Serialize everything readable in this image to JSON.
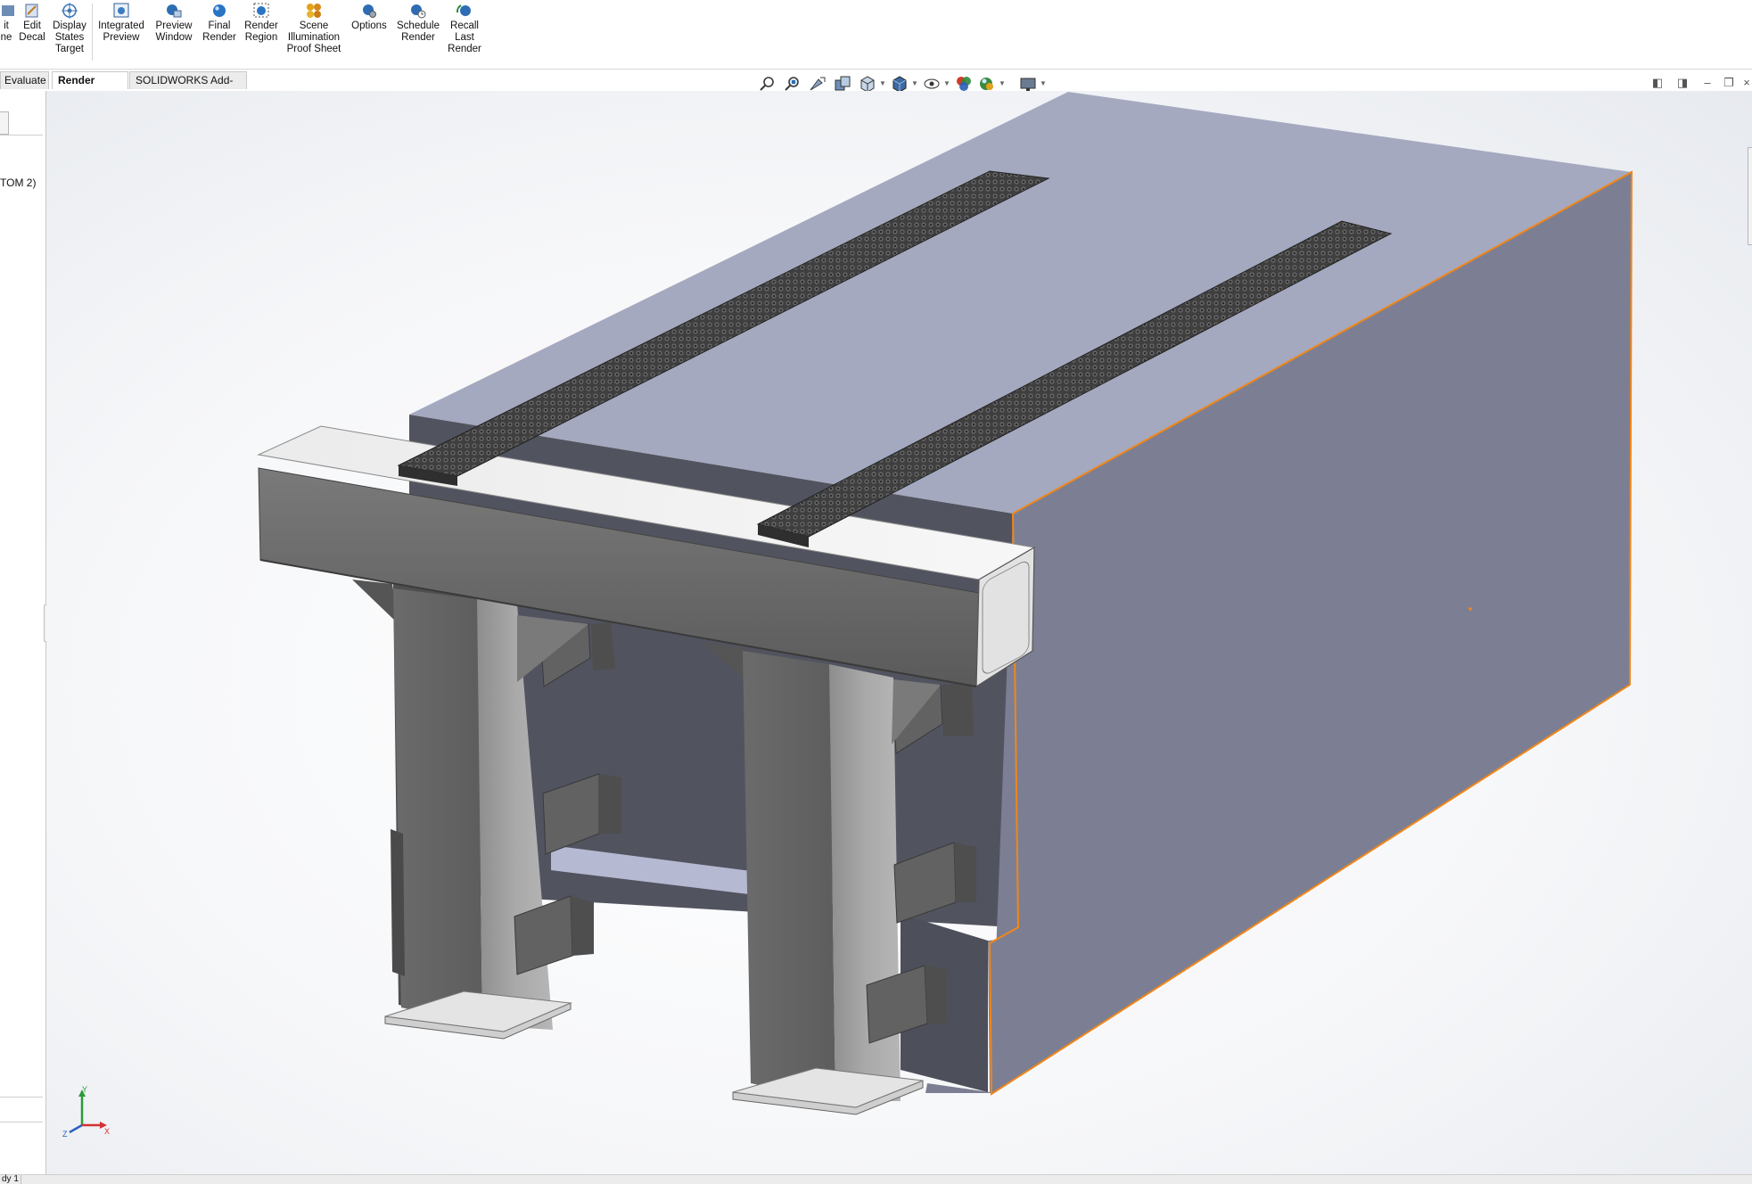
{
  "ribbon": {
    "buttons": [
      {
        "label": "it\nne",
        "icon": "edit-scene-icon"
      },
      {
        "label": "Edit\nDecal",
        "icon": "edit-decal-icon"
      },
      {
        "label": "Display\nStates\nTarget",
        "icon": "display-states-target-icon"
      },
      {
        "label": "Integrated\nPreview",
        "icon": "integrated-preview-icon"
      },
      {
        "label": "Preview\nWindow",
        "icon": "preview-window-icon"
      },
      {
        "label": "Final\nRender",
        "icon": "final-render-icon"
      },
      {
        "label": "Render\nRegion",
        "icon": "render-region-icon"
      },
      {
        "label": "Scene\nIllumination\nProof Sheet",
        "icon": "scene-illumination-icon"
      },
      {
        "label": "Options",
        "icon": "options-icon"
      },
      {
        "label": "Schedule\nRender",
        "icon": "schedule-render-icon"
      },
      {
        "label": "Recall\nLast\nRender",
        "icon": "recall-last-render-icon"
      }
    ]
  },
  "tabs": [
    {
      "label": "Evaluate",
      "active": false
    },
    {
      "label": "Render Tools",
      "active": true
    },
    {
      "label": "SOLIDWORKS Add-Ins",
      "active": false
    }
  ],
  "left_panel": {
    "config_text": "TOM 2)"
  },
  "heads_up_toolbar": {
    "icons": [
      "zoom-to-fit-icon",
      "zoom-to-area-icon",
      "previous-view-icon",
      "section-view-icon",
      "view-orientation-icon",
      "display-style-icon",
      "hide-show-items-icon",
      "edit-appearance-icon",
      "apply-scene-icon",
      "view-settings-icon"
    ]
  },
  "triad": {
    "x": "X",
    "y": "Y",
    "z": "Z"
  },
  "status_bar": {
    "tab": "dy 1"
  },
  "colors": {
    "block_top": "#a5a9bf",
    "block_side": "#7c7f93",
    "block_dark": "#51535f",
    "steel_light": "#efefef",
    "steel_mid": "#a6a6a6",
    "steel_dark": "#5e5e5e",
    "selection_edge": "#f0861a",
    "rail_dark": "#3b3b3b"
  }
}
